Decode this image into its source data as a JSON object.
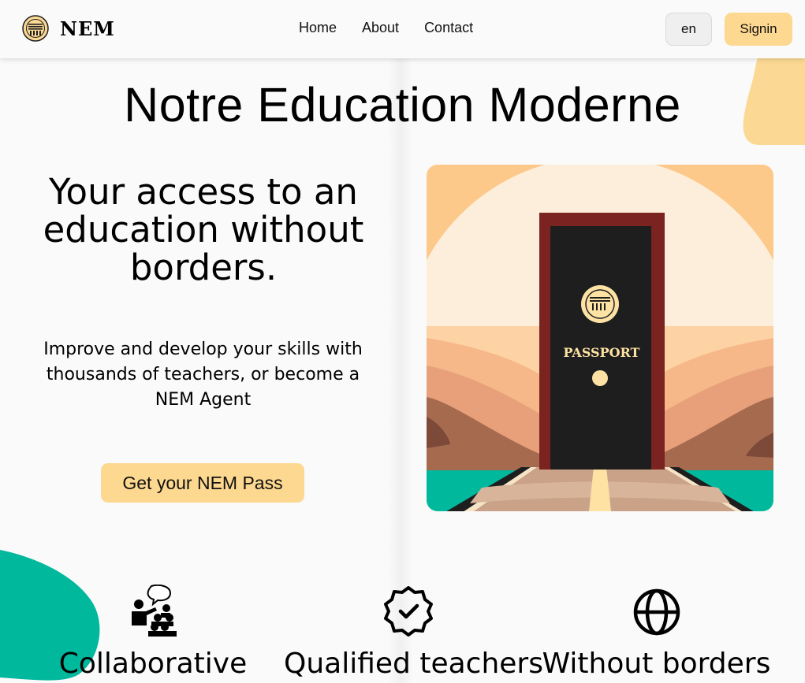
{
  "header": {
    "brand": "NEM",
    "nav": [
      {
        "label": "Home"
      },
      {
        "label": "About"
      },
      {
        "label": "Contact"
      }
    ],
    "language_label": "en",
    "signin_label": "Signin"
  },
  "hero": {
    "title": "Notre Education Moderne",
    "heading": "Your access to an education without borders.",
    "text": "Improve and develop your skills with thousands of teachers, or become a NEM Agent",
    "cta_label": "Get your NEM Pass",
    "image": {
      "passport_label": "PASSPORT"
    }
  },
  "features": [
    {
      "label": "Collaborative",
      "icon": "collaboration-icon"
    },
    {
      "label": "Qualified teachers",
      "icon": "verified-badge-icon"
    },
    {
      "label": "Without borders",
      "icon": "globe-icon"
    }
  ],
  "colors": {
    "accent_yellow": "#fdd890",
    "teal": "#00b89c",
    "door_frame": "#7a2320",
    "door": "#1e1e1e"
  }
}
